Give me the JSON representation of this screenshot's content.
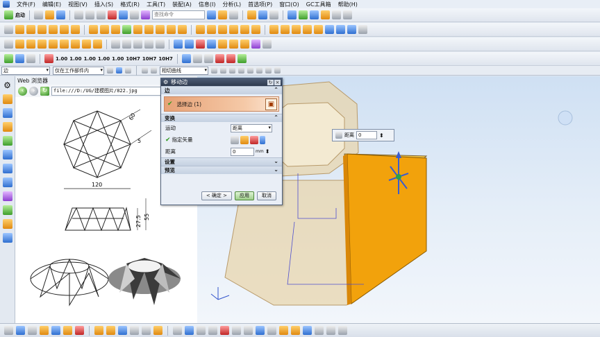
{
  "menu": [
    "文件(F)",
    "编辑(E)",
    "视图(V)",
    "插入(S)",
    "格式(R)",
    "工具(T)",
    "装配(A)",
    "信息(I)",
    "分析(L)",
    "首选项(P)",
    "窗口(O)",
    "GC工具箱",
    "帮助(H)"
  ],
  "toolbar": {
    "start_label": "启动",
    "search_placeholder": "查找命令",
    "dim_labels": [
      "1.00",
      "1.00",
      "1.00",
      "1.00",
      "1.00",
      "10H7",
      "10H7",
      "10H7"
    ]
  },
  "selection_bar": {
    "filter_value": "边",
    "scope_value": "仅在工作部件内",
    "curve_rule_value": "相切曲线"
  },
  "web_browser": {
    "title": "Web 浏览器",
    "url": "file:///D:/UG/建模图片/822.jpg",
    "drawing": {
      "dim_top": "60",
      "dim_side": "5",
      "dim_width": "120",
      "dim_h1": "27.5",
      "dim_h2": "55"
    }
  },
  "dialog": {
    "title": "移动边",
    "sections": {
      "edge": "边",
      "transform": "变换",
      "settings": "设置",
      "preview": "预览"
    },
    "select_edge_label": "选择边 (1)",
    "motion_label": "运动",
    "motion_value": "距离",
    "vector_label": "指定矢量",
    "distance_label": "距离",
    "distance_value": "0",
    "distance_unit": "mm",
    "buttons": {
      "ok": "< 确定 >",
      "apply": "应用",
      "cancel": "取消"
    }
  },
  "on_screen_input": {
    "label": "距离",
    "value": "0"
  },
  "colors": {
    "accent_face": "#f2a20c",
    "body": "#e8d5ae",
    "dialog_title": "#3a475d",
    "selection_row": "#eeb38c"
  }
}
